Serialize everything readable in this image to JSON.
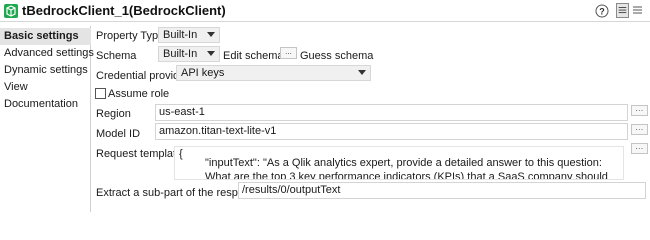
{
  "window": {
    "title": "tBedrockClient_1(BedrockClient)"
  },
  "colors": {
    "app_icon_bg": "#1fa84f",
    "active_item_bg": "#e4e4e4",
    "border": "#d4d4d4"
  },
  "sidebar": {
    "items": [
      {
        "label": "Basic settings",
        "active": true
      },
      {
        "label": "Advanced settings",
        "active": false
      },
      {
        "label": "Dynamic settings",
        "active": false
      },
      {
        "label": "View",
        "active": false
      },
      {
        "label": "Documentation",
        "active": false
      }
    ]
  },
  "form": {
    "property_type": {
      "label": "Property Type",
      "value": "Built-In"
    },
    "schema": {
      "label": "Schema",
      "value": "Built-In",
      "edit_label": "Edit schema",
      "edit_button": "...",
      "guess_label": "Guess schema"
    },
    "credential_provider": {
      "label": "Credential provider",
      "value": "API keys"
    },
    "assume_role": {
      "label": "Assume role",
      "checked": false
    },
    "region": {
      "label": "Region",
      "value": "us-east-1",
      "button": "..."
    },
    "model_id": {
      "label": "Model ID",
      "value": "amazon.titan-text-lite-v1",
      "button": "..."
    },
    "request_template": {
      "label": "Request template",
      "line1": "{",
      "line2": "\"inputText\": \"As a Qlik analytics expert, provide a detailed answer to this question: What are the top 3 key performance indicators (KPIs) that a SaaS company should track to measure customer success?\"",
      "button": "..."
    },
    "extract": {
      "label": "Extract a sub-part of the response",
      "value": "/results/0/outputText"
    }
  }
}
